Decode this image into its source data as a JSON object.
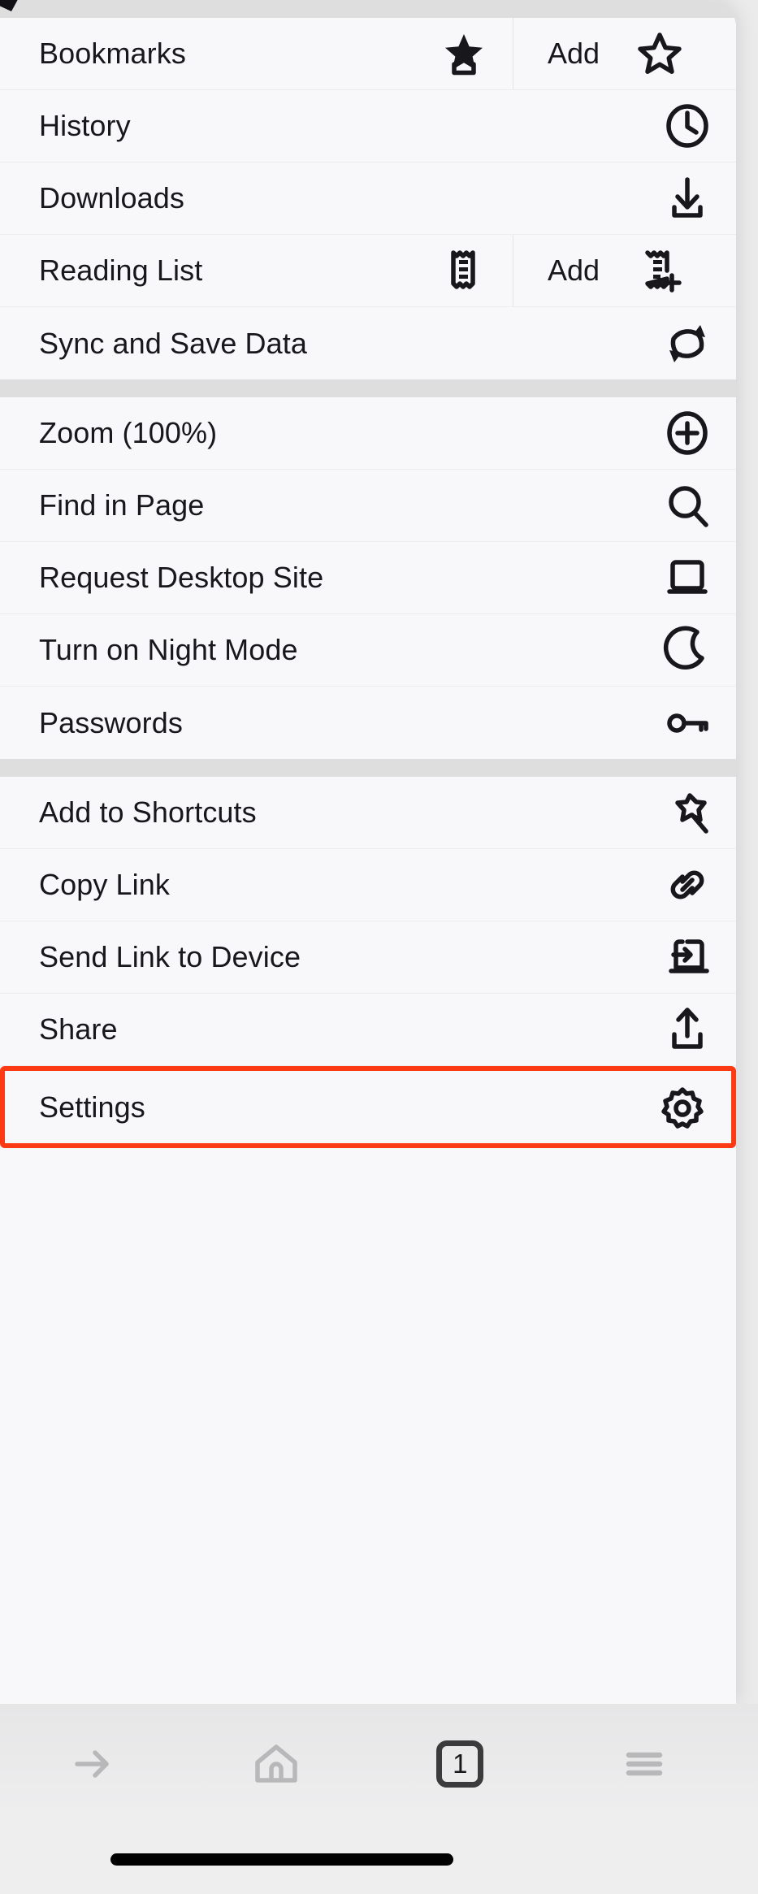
{
  "menu": {
    "groups": [
      {
        "id": "library",
        "items": [
          {
            "label": "Bookmarks",
            "icon": "bookmark-filled-icon",
            "secondary": {
              "label": "Add",
              "icon": "star-outline-icon"
            }
          },
          {
            "label": "History",
            "icon": "clock-icon"
          },
          {
            "label": "Downloads",
            "icon": "download-icon"
          },
          {
            "label": "Reading List",
            "icon": "reading-list-icon",
            "secondary": {
              "label": "Add",
              "icon": "reading-list-add-icon"
            }
          },
          {
            "label": "Sync and Save Data",
            "icon": "sync-icon"
          }
        ]
      },
      {
        "id": "page-tools",
        "items": [
          {
            "label": "Zoom (100%)",
            "icon": "zoom-in-icon"
          },
          {
            "label": "Find in Page",
            "icon": "search-icon"
          },
          {
            "label": "Request Desktop Site",
            "icon": "desktop-icon"
          },
          {
            "label": "Turn on Night Mode",
            "icon": "moon-icon"
          },
          {
            "label": "Passwords",
            "icon": "key-icon"
          }
        ]
      },
      {
        "id": "share-tools",
        "items": [
          {
            "label": "Add to Shortcuts",
            "icon": "pin-icon"
          },
          {
            "label": "Copy Link",
            "icon": "link-icon"
          },
          {
            "label": "Send Link to Device",
            "icon": "send-to-device-icon"
          },
          {
            "label": "Share",
            "icon": "share-upload-icon"
          },
          {
            "label": "Settings",
            "icon": "gear-icon",
            "highlighted": true
          }
        ]
      }
    ]
  },
  "toolbar": {
    "forward_label": "forward-arrow-icon",
    "home_label": "home-icon",
    "tab_count": "1",
    "menu_label": "hamburger-menu-icon"
  },
  "colors": {
    "sheet_background": "#f8f8fa",
    "separator": "#dededf",
    "text": "#17171c",
    "highlight_border": "#fc3a13",
    "toolbar_inactive": "#b8b8ba",
    "tab_box_border": "#3b3b3d",
    "home_indicator": "#000000"
  }
}
